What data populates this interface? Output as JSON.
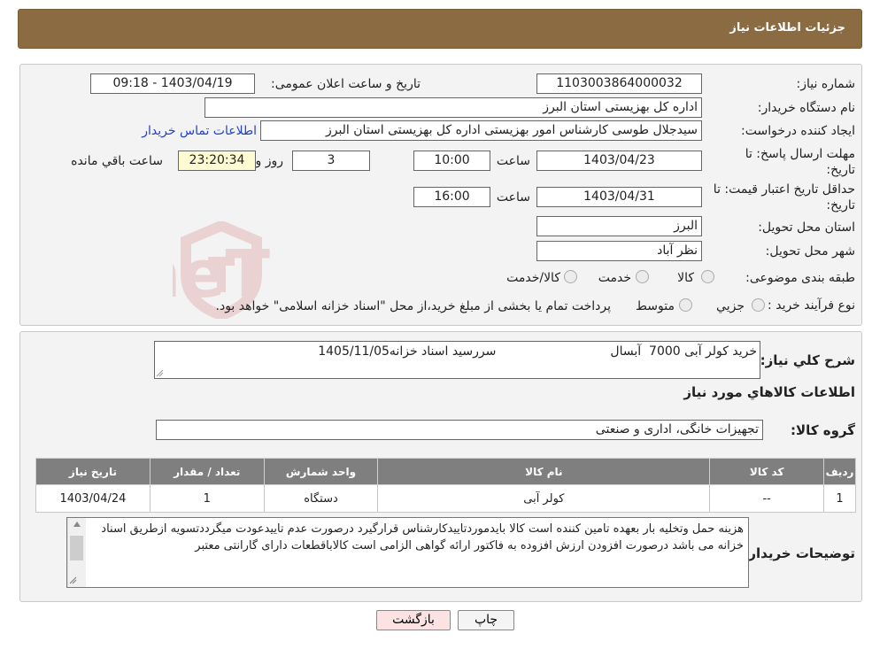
{
  "header": {
    "title": "جزئیات اطلاعات نیاز"
  },
  "form": {
    "need_number_label": "شماره نیاز:",
    "need_number": "1103003864000032",
    "announce_label": "تاریخ و ساعت اعلان عمومی:",
    "announce_value": "1403/04/19 - 09:18",
    "buyer_org_label": "نام دستگاه خریدار:",
    "buyer_org": "اداره کل بهزیستی استان البرز",
    "creator_label": "ایجاد کننده درخواست:",
    "creator": "سیدجلال طوسی کارشناس امور بهزیستی اداره کل بهزیستی استان البرز",
    "contact_link": "اطلاعات تماس خریدار",
    "deadline_label": "مهلت ارسال پاسخ: تا تاریخ:",
    "deadline_date": "1403/04/23",
    "time_label": "ساعت",
    "deadline_time": "10:00",
    "days_value": "3",
    "days_label": "روز و",
    "remaining_value": "23:20:34",
    "remaining_label": "ساعت باقي مانده",
    "validity_label": "حداقل تاریخ اعتبار قیمت: تا تاریخ:",
    "validity_date": "1403/04/31",
    "validity_time": "16:00",
    "province_label": "استان محل تحویل:",
    "province": "البرز",
    "city_label": "شهر محل تحویل:",
    "city": "نظر آباد",
    "category_label": "طبقه بندی موضوعی:",
    "category_options": [
      "کالا",
      "خدمت",
      "کالا/خدمت"
    ],
    "purchase_type_label": "نوع فرآیند خرید :",
    "purchase_options": [
      "جزیي",
      "متوسط"
    ],
    "purchase_note": "پرداخت تمام یا بخشی از مبلغ خرید،از محل \"اسناد خزانه اسلامی\" خواهد بود."
  },
  "summary": {
    "description_label": "شرح کلي نیاز:",
    "description": "خرید کولر آبی 7000  آبسال                             سررسید اسناد خزانه1405/11/05",
    "items_heading": "اطلاعات کالاهاي مورد نیاز",
    "group_label": "گروه کالا:",
    "group_value": "تجهیزات خانگی، اداری و صنعتی"
  },
  "table": {
    "headers": [
      "ردیف",
      "کد کالا",
      "نام کالا",
      "واحد شمارش",
      "تعداد / مقدار",
      "تاریخ نیاز"
    ],
    "rows": [
      [
        "1",
        "--",
        "کولر آبی",
        "دستگاه",
        "1",
        "1403/04/24"
      ]
    ]
  },
  "notes": {
    "label": "توضیحات خریدار:",
    "text": "هزینه حمل وتخلیه بار بعهده تامین کننده است کالا بایدموردتاییدکارشناس قرارگیرد درصورت عدم تاییدعودت میگرددتسویه ازطریق اسناد خزانه می باشد درصورت افزودن ارزش افزوده به فاکتور ارائه گواهی الزامی است کالاباقطعات دارای گارانتی معتبر"
  },
  "buttons": {
    "print": "چاپ",
    "back": "بازگشت"
  },
  "watermark": {
    "text": "AriaTender.neT"
  },
  "colors": {
    "header_bg": "#8a6b42",
    "link": "#2241c7",
    "table_header": "#7f7f7f",
    "back_button": "#fbe3e3",
    "remaining_bg": "#fdfbd2"
  }
}
